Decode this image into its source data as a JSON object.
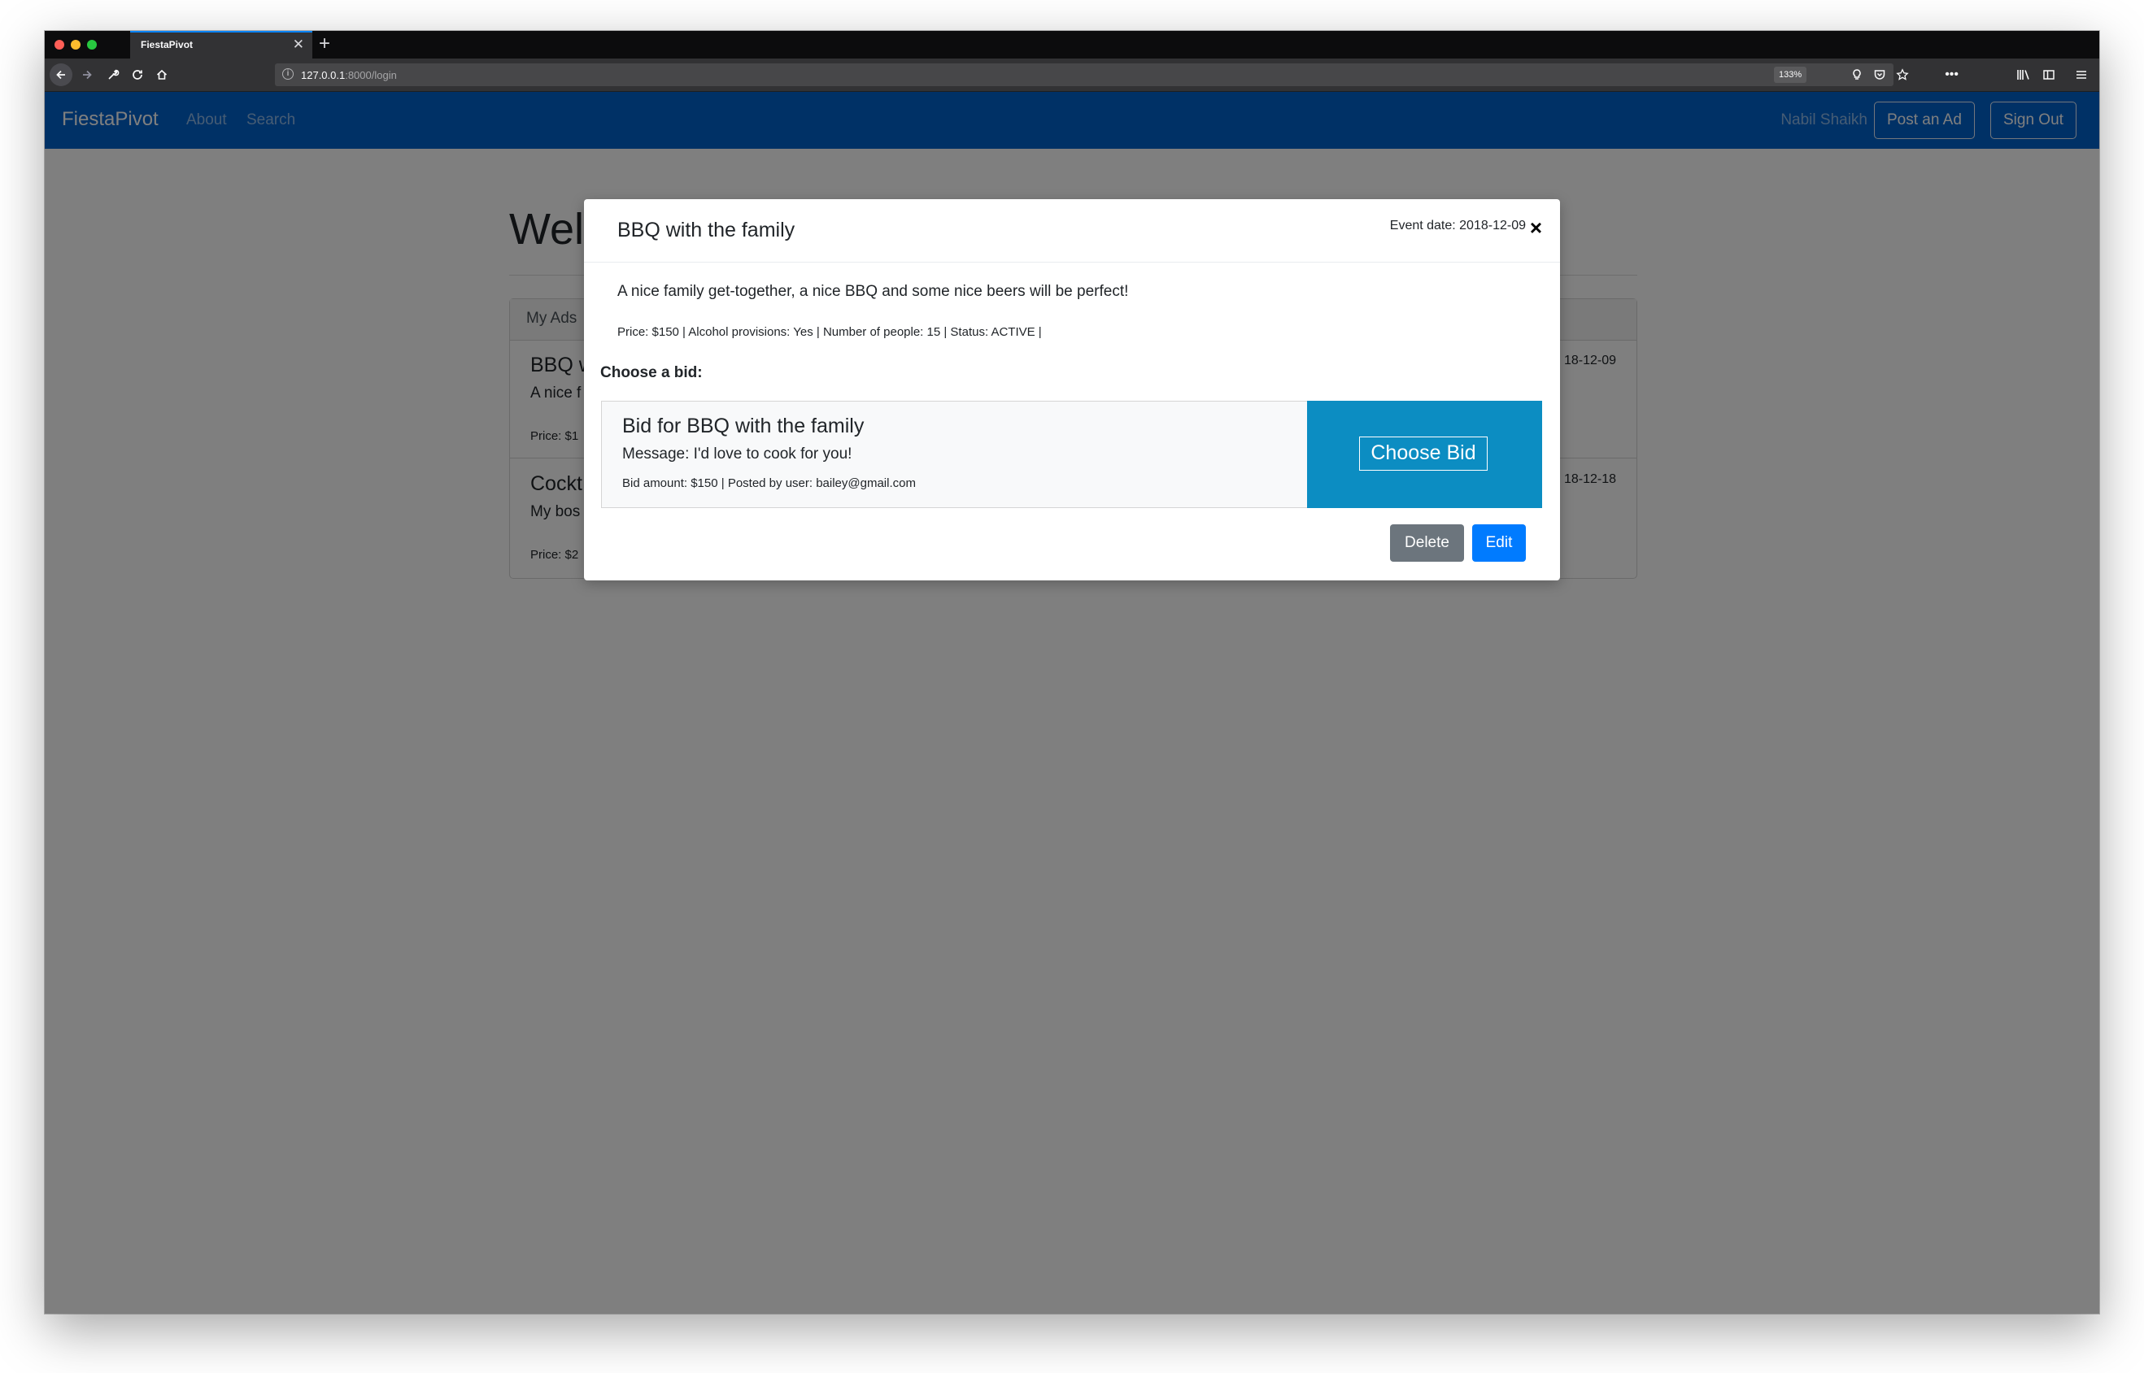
{
  "browser": {
    "tab_title": "FiestaPivot",
    "tab_close": "✕",
    "new_tab": "+",
    "url_host": "127.0.0.1",
    "url_path": ":8000/login",
    "zoom": "133%"
  },
  "nav": {
    "brand": "FiestaPivot",
    "links": [
      "About",
      "Search"
    ],
    "user": "Nabil Shaikh",
    "post_ad": "Post an Ad",
    "sign_out": "Sign Out"
  },
  "page": {
    "welcome": "Welc",
    "tab_my_ads": "My Ads",
    "ads": [
      {
        "title": "BBQ w",
        "desc": "A nice f",
        "meta": "Price: $1",
        "date": "18-12-09"
      },
      {
        "title": "Cockt",
        "desc": "My bos",
        "meta": "Price: $2",
        "date": "18-12-18"
      }
    ]
  },
  "modal": {
    "title": "BBQ with the family",
    "event_date": "Event date: 2018-12-09",
    "close": "×",
    "description": "A nice family get-together, a nice BBQ and some nice beers will be perfect!",
    "meta": "Price: $150 | Alcohol provisions: Yes | Number of people: 15 | Status: ACTIVE |",
    "choose_label": "Choose a bid:",
    "bid": {
      "title": "Bid for BBQ with the family",
      "message": "Message: I'd love to cook for you!",
      "meta": "Bid amount: $150 | Posted by user: bailey@gmail.com",
      "choose_button": "Choose Bid"
    },
    "delete_button": "Delete",
    "edit_button": "Edit"
  },
  "colors": {
    "navbar": "#0062cc",
    "bid_action": "#0c8dc2",
    "edit_button": "#007bff",
    "delete_button": "#6c757d"
  }
}
